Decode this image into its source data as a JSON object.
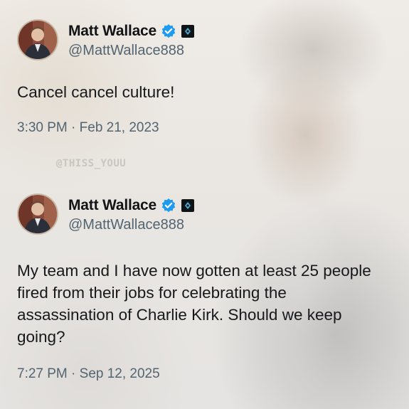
{
  "tweets": [
    {
      "author": {
        "name": "Matt Wallace",
        "handle": "@MattWallace888",
        "verified_icon": "verified-badge-icon",
        "affiliate_icon": "affiliate-badge-icon"
      },
      "text": "Cancel cancel culture!",
      "timestamp": "3:30 PM · Feb 21, 2023"
    },
    {
      "author": {
        "name": "Matt Wallace",
        "handle": "@MattWallace888",
        "verified_icon": "verified-badge-icon",
        "affiliate_icon": "affiliate-badge-icon"
      },
      "text": "My team and I have now gotten at least 25 people fired from their jobs for celebrating the assassination of Charlie Kirk. Should we keep going?",
      "timestamp": "7:27 PM · Sep 12, 2025"
    }
  ],
  "watermark": "@THISS_YOUU",
  "colors": {
    "verified_blue": "#1d9bf0",
    "text_primary": "#16181c",
    "text_secondary": "#536471"
  }
}
